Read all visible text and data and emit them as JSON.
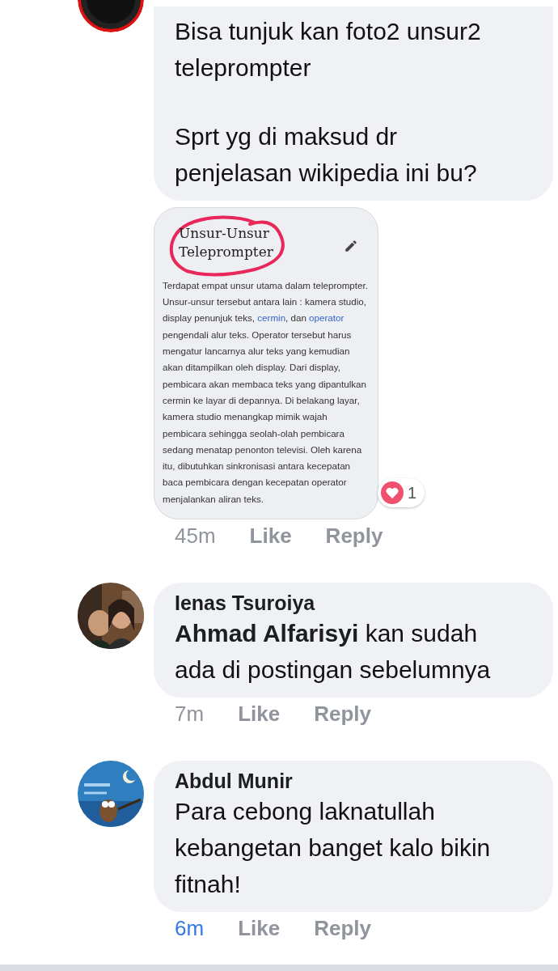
{
  "comments": [
    {
      "paragraphs": [
        "Bisa tunjuk kan foto2 unsur2 teleprompter",
        "Sprt yg di maksud dr penjelasan wikipedia ini bu?"
      ],
      "attachment": {
        "title": "Unsur-Unsur Teleprompter",
        "body": [
          {
            "kind": "plain",
            "text": "Terdapat empat unsur utama dalam teleprompter. Unsur-unsur tersebut antara lain : kamera studio, display penunjuk teks, "
          },
          {
            "kind": "link",
            "text": "cermin"
          },
          {
            "kind": "plain",
            "text": ", dan "
          },
          {
            "kind": "link",
            "text": "operator"
          },
          {
            "kind": "plain",
            "text": " pengendali alur teks. Operator tersebut harus mengatur lancarnya alur teks yang kemudian akan ditampilkan oleh display. Dari display, pembicara akan membaca teks yang dipantulkan cermin ke layar di depannya. Di belakang layar, kamera studio menangkap mimik wajah pembicara sehingga seolah-olah pembicara sedang menatap penonton televisi. Oleh karena itu, dibutuhkan sinkronisasi antara kecepatan baca pembicara dengan kecepatan operator menjalankan aliran teks."
          }
        ],
        "reaction_count": "1"
      },
      "time": "45m",
      "time_highlighted": false,
      "actions": [
        "Like",
        "Reply"
      ]
    },
    {
      "author": "Ienas Tsuroiya",
      "mention": "Ahmad Alfarisyi",
      "paragraphs": [
        "kan sudah ada di postingan sebelumnya"
      ],
      "time": "7m",
      "time_highlighted": false,
      "actions": [
        "Like",
        "Reply"
      ]
    },
    {
      "author": "Abdul Munir",
      "paragraphs": [
        "Para cebong laknatullah kebangetan banget kalo bikin fitnah!"
      ],
      "time": "6m",
      "time_highlighted": true,
      "actions": [
        "Like",
        "Reply"
      ]
    }
  ]
}
